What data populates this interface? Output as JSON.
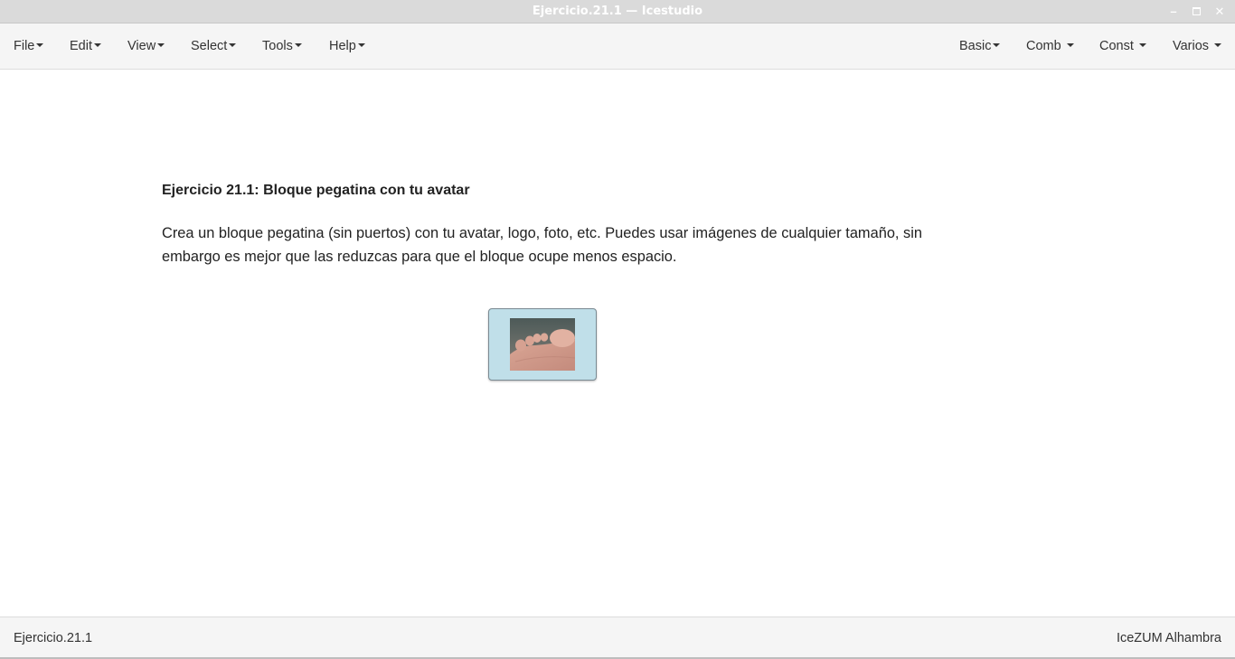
{
  "window": {
    "title": "Ejercicio.21.1 — Icestudio",
    "minimize_glyph": "–",
    "close_glyph": "✕"
  },
  "menubar": {
    "left": [
      "File",
      "Edit",
      "View",
      "Select",
      "Tools",
      "Help"
    ],
    "right": [
      "Basic",
      "Comb",
      "Const",
      "Varios"
    ]
  },
  "canvas": {
    "info_title": "Ejercicio 21.1: Bloque pegatina con tu avatar",
    "info_text": "Crea un bloque pegatina (sin puertos) con tu avatar, logo, foto, etc. Puedes usar imágenes de cualquier tamaño, sin embargo es mejor que las reduzcas para que el bloque ocupe menos espacio.",
    "sticker_icon": "photo-of-toes"
  },
  "statusbar": {
    "file": "Ejercicio.21.1",
    "board": "IceZUM Alhambra"
  },
  "colors": {
    "titlebar_bg": "#dadada",
    "bar_bg": "#f5f5f5",
    "sticker_bg": "#c0dfe9"
  }
}
